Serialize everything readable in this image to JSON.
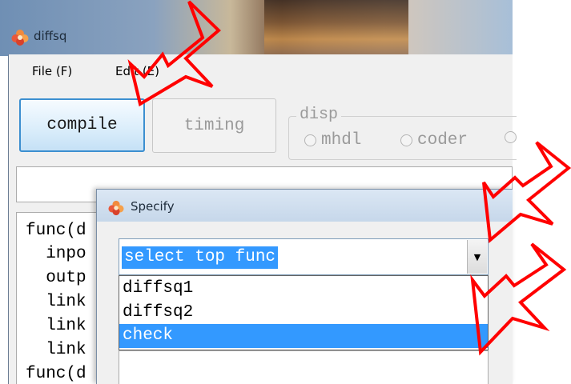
{
  "window": {
    "title": "diffsq",
    "app_icon": "flower-icon"
  },
  "menu": {
    "file": "File (F)",
    "edit": "Edit (E)"
  },
  "toolbar": {
    "compile_label": "compile",
    "timing_label": "timing",
    "disp_label": "disp",
    "radio_mhdl": "mhdl",
    "radio_coder": "coder"
  },
  "editor": {
    "lines": [
      "func(d",
      "  inpo",
      "  outp",
      "  link",
      "  link",
      "  link",
      "func(d"
    ]
  },
  "dialog": {
    "title": "Specify",
    "combo_value": "select top func",
    "options": [
      "diffsq1",
      "diffsq2",
      "check"
    ],
    "selected_option": "check"
  },
  "colors": {
    "selection": "#3399ff",
    "annotation_arrow": "#ff0000",
    "button_border": "#3c8fd0"
  }
}
